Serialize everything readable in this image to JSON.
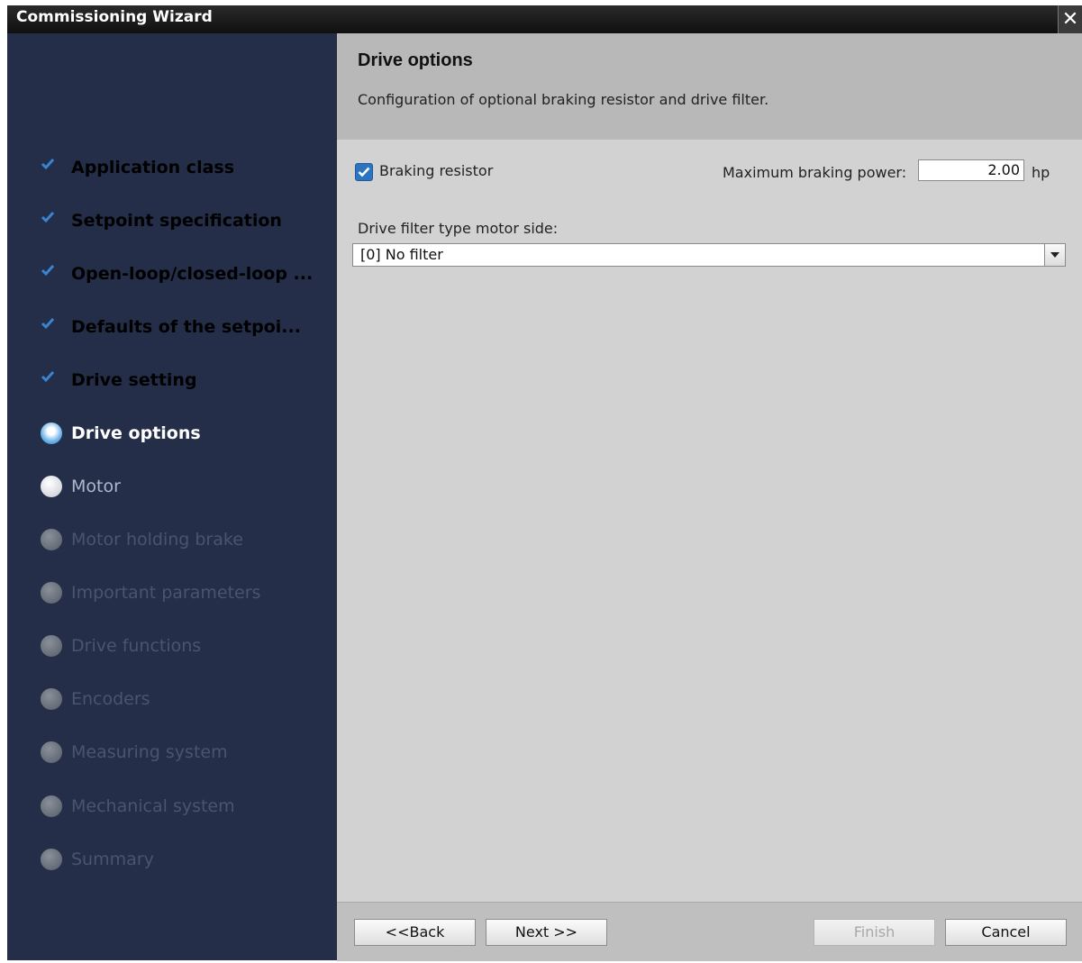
{
  "window": {
    "title": "Commissioning Wizard",
    "close_glyph": "✕"
  },
  "steps": [
    {
      "label": "Application class",
      "state": "done"
    },
    {
      "label": "Setpoint specification",
      "state": "done"
    },
    {
      "label": "Open-loop/closed-loop ...",
      "state": "done"
    },
    {
      "label": "Defaults of the setpoi...",
      "state": "done"
    },
    {
      "label": "Drive setting",
      "state": "done"
    },
    {
      "label": "Drive options",
      "state": "current"
    },
    {
      "label": "Motor",
      "state": "next"
    },
    {
      "label": "Motor holding brake",
      "state": "disabled"
    },
    {
      "label": "Important parameters",
      "state": "disabled"
    },
    {
      "label": "Drive functions",
      "state": "disabled"
    },
    {
      "label": "Encoders",
      "state": "disabled"
    },
    {
      "label": "Measuring system",
      "state": "disabled"
    },
    {
      "label": "Mechanical system",
      "state": "disabled"
    },
    {
      "label": "Summary",
      "state": "disabled"
    }
  ],
  "header": {
    "title": "Drive options",
    "description": "Configuration of optional braking resistor and drive filter."
  },
  "form": {
    "braking_resistor_label": "Braking resistor",
    "braking_resistor_checked": true,
    "max_power_label": "Maximum braking power:",
    "max_power_value": "2.00",
    "max_power_unit": "hp",
    "filter_label": "Drive filter type motor side:",
    "filter_value": "[0] No filter"
  },
  "buttons": {
    "back": "<<Back",
    "next": "Next >>",
    "finish": "Finish",
    "cancel": "Cancel"
  },
  "colors": {
    "sidebar": "#242e48",
    "accent": "#2c74c0"
  }
}
